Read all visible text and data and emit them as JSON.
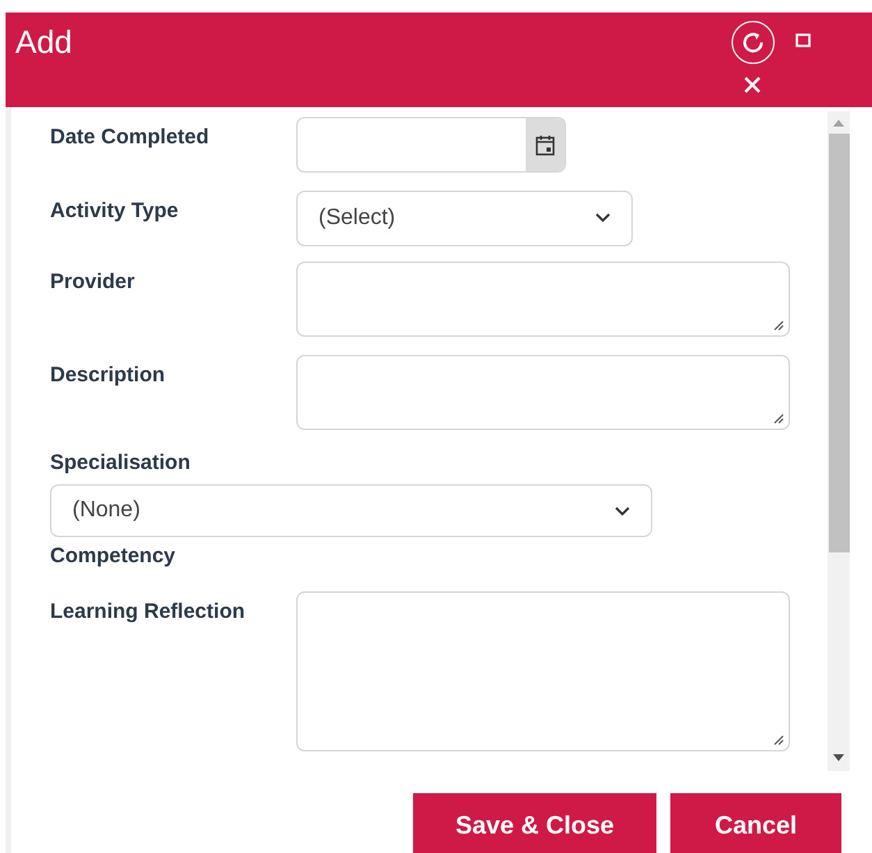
{
  "window": {
    "title": "Add"
  },
  "fields": [
    {
      "kind": "date",
      "label": "Date Completed"
    },
    {
      "kind": "select",
      "label": "Activity Type",
      "value": "(Select)"
    },
    {
      "kind": "textarea",
      "label": "Provider"
    },
    {
      "kind": "textarea",
      "label": "Description"
    },
    {
      "kind": "wide-select",
      "label": "Specialisation",
      "value": "(None)"
    },
    {
      "kind": "label",
      "label": "Competency"
    },
    {
      "kind": "big-textarea",
      "label": "Learning Reflection"
    }
  ],
  "buttons": [
    "Save & Close",
    "Cancel"
  ]
}
